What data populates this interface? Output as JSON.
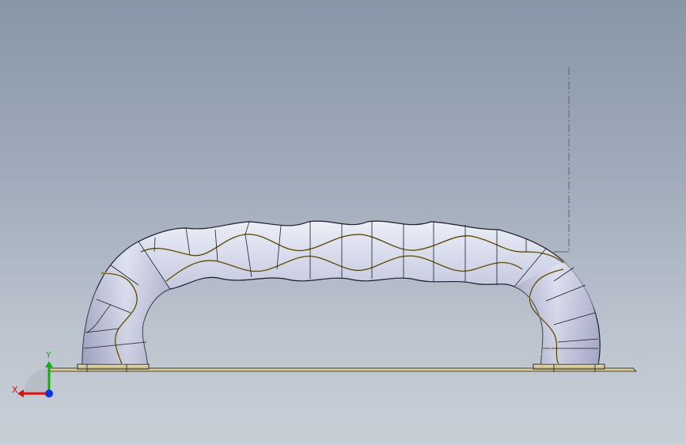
{
  "triad": {
    "x_label": "X",
    "y_label": "Y",
    "x_color": "#e01010",
    "y_color": "#10b010",
    "z_color": "#1030e0"
  },
  "colors": {
    "background_top": "#8796a8",
    "background_bottom": "#c9cfd7",
    "surface_light": "#e6e8f4",
    "surface_mid": "#b9bdd6",
    "surface_dark": "#8d91b0",
    "edge": "#222222",
    "seam_highlight": "#c8b46a",
    "base_plate": "#e8dcb0"
  }
}
